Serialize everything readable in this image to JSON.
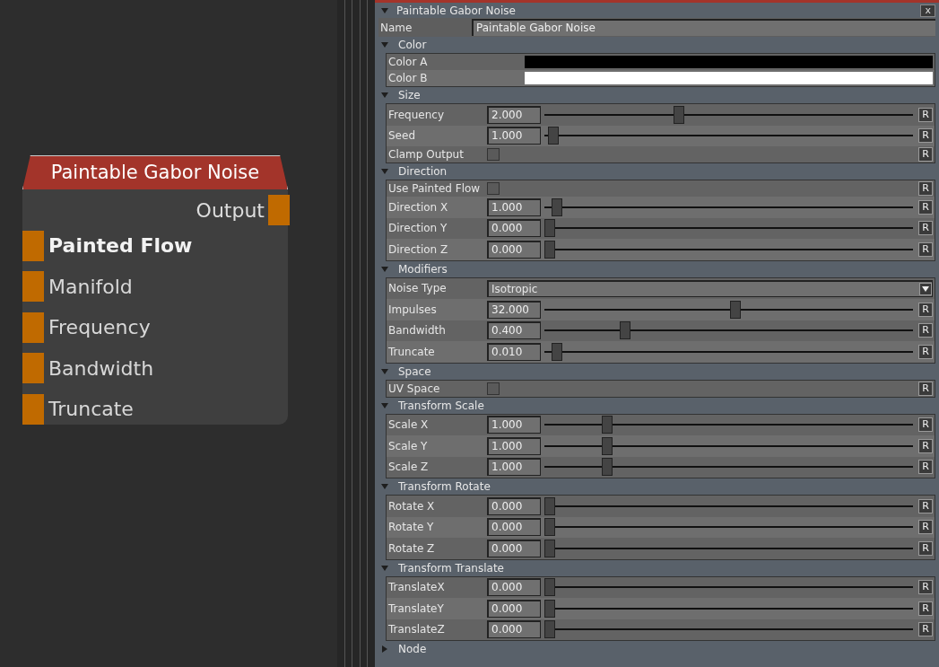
{
  "node": {
    "title": "Paintable Gabor Noise",
    "output": {
      "label": "Output"
    },
    "inputs": [
      {
        "label": "Painted Flow",
        "active": true
      },
      {
        "label": "Manifold",
        "active": false
      },
      {
        "label": "Frequency",
        "active": false
      },
      {
        "label": "Bandwidth",
        "active": false
      },
      {
        "label": "Truncate",
        "active": false
      }
    ]
  },
  "panel": {
    "title": "Paintable Gabor Noise",
    "expanded": true,
    "close": "x",
    "name_label": "Name",
    "name_value": "Paintable Gabor Noise",
    "sections": [
      {
        "title": "Color",
        "expanded": true,
        "rows": [
          {
            "kind": "color",
            "label": "Color A",
            "color": "#000000"
          },
          {
            "kind": "color",
            "label": "Color B",
            "color": "#ffffff"
          }
        ]
      },
      {
        "title": "Size",
        "expanded": true,
        "rows": [
          {
            "kind": "slider",
            "label": "Frequency",
            "value": "2.000",
            "level": 0.36,
            "reset": "R"
          },
          {
            "kind": "slider",
            "label": "Seed",
            "value": "1.000",
            "level": 0.01,
            "reset": "R"
          },
          {
            "kind": "checkbox",
            "label": "Clamp Output",
            "checked": false,
            "reset": "R"
          }
        ]
      },
      {
        "title": "Direction",
        "expanded": true,
        "rows": [
          {
            "kind": "checkbox",
            "label": "Use Painted Flow",
            "checked": false,
            "reset": "R"
          },
          {
            "kind": "slider",
            "label": "Direction X",
            "value": "1.000",
            "level": 0.02,
            "reset": "R"
          },
          {
            "kind": "slider",
            "label": "Direction Y",
            "value": "0.000",
            "level": 0.0,
            "reset": "R"
          },
          {
            "kind": "slider",
            "label": "Direction Z",
            "value": "0.000",
            "level": 0.0,
            "reset": "R"
          }
        ]
      },
      {
        "title": "Modifiers",
        "expanded": true,
        "rows": [
          {
            "kind": "dropdown",
            "label": "Noise Type",
            "value": "Isotropic"
          },
          {
            "kind": "slider",
            "label": "Impulses",
            "value": "32.000",
            "level": 0.52,
            "reset": "R"
          },
          {
            "kind": "slider",
            "label": "Bandwidth",
            "value": "0.400",
            "level": 0.21,
            "reset": "R"
          },
          {
            "kind": "slider",
            "label": "Truncate",
            "value": "0.010",
            "level": 0.02,
            "reset": "R"
          }
        ]
      },
      {
        "title": "Space",
        "expanded": true,
        "rows": [
          {
            "kind": "checkbox",
            "label": "UV Space",
            "checked": false,
            "reset": "R"
          }
        ]
      },
      {
        "title": "Transform Scale",
        "expanded": true,
        "rows": [
          {
            "kind": "slider",
            "label": "Scale X",
            "value": "1.000",
            "level": 0.16,
            "reset": "R"
          },
          {
            "kind": "slider",
            "label": "Scale Y",
            "value": "1.000",
            "level": 0.16,
            "reset": "R"
          },
          {
            "kind": "slider",
            "label": "Scale Z",
            "value": "1.000",
            "level": 0.16,
            "reset": "R"
          }
        ]
      },
      {
        "title": "Transform Rotate",
        "expanded": true,
        "rows": [
          {
            "kind": "slider",
            "label": "Rotate X",
            "value": "0.000",
            "level": 0.0,
            "reset": "R"
          },
          {
            "kind": "slider",
            "label": "Rotate Y",
            "value": "0.000",
            "level": 0.0,
            "reset": "R"
          },
          {
            "kind": "slider",
            "label": "Rotate Z",
            "value": "0.000",
            "level": 0.0,
            "reset": "R"
          }
        ]
      },
      {
        "title": "Transform Translate",
        "expanded": true,
        "rows": [
          {
            "kind": "slider",
            "label": "TranslateX",
            "value": "0.000",
            "level": 0.0,
            "reset": "R"
          },
          {
            "kind": "slider",
            "label": "TranslateY",
            "value": "0.000",
            "level": 0.0,
            "reset": "R"
          },
          {
            "kind": "slider",
            "label": "TranslateZ",
            "value": "0.000",
            "level": 0.0,
            "reset": "R"
          }
        ]
      },
      {
        "title": "Node",
        "expanded": false
      }
    ]
  }
}
